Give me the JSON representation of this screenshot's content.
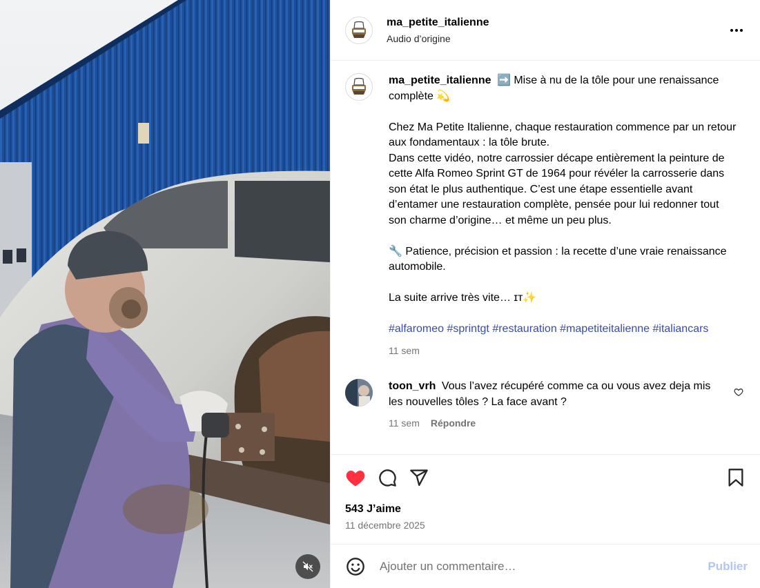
{
  "post": {
    "username": "ma_petite_italienne",
    "audio": "Audio d’origine"
  },
  "caption": {
    "username": "ma_petite_italienne",
    "line1_emoji": "➡️",
    "line1": "Mise à nu de la tôle pour une renaissance complète",
    "line1_end_emoji": "💫",
    "para2": "Chez Ma Petite Italienne, chaque restauration commence par un retour aux fondamentaux : la tôle brute.",
    "para3": "Dans cette vidéo, notre carrossier décape entièrement la peinture de cette Alfa Romeo Sprint GT de 1964 pour révéler la carrosserie dans son état le plus authentique. C’est une étape essentielle avant d’entamer une restauration complète, pensée pour lui redonner tout son charme d’origine… et même un peu plus.",
    "para4_emoji": "🔧",
    "para4": "Patience, précision et passion : la recette d’une vraie renaissance automobile.",
    "para5": "La suite arrive très vite… ɪᴛ✨",
    "hashtags": [
      "#alfaromeo",
      "#sprintgt",
      "#restauration",
      "#mapetiteitalienne",
      "#italiancars"
    ],
    "time": "11 sem"
  },
  "comment": {
    "username": "toon_vrh",
    "text": "Vous l’avez récupéré comme ca ou vous avez deja mis les nouvelles tôles ? La face avant ?",
    "time": "11 sem",
    "reply_label": "Répondre"
  },
  "stats": {
    "likes": "543 J’aime",
    "date": "11 décembre 2025"
  },
  "add_comment": {
    "placeholder": "Ajouter un commentaire…",
    "publish_label": "Publier"
  },
  "colors": {
    "like_red": "#ff3040",
    "hashtag": "#3a4aa8",
    "publish_disabled": "#b2c6f5",
    "muted_text": "#737373"
  },
  "icons": [
    "more-options-icon",
    "heart-filled-icon",
    "comment-icon",
    "share-icon",
    "bookmark-icon",
    "emoji-icon",
    "muted-speaker-icon",
    "heart-outline-icon"
  ]
}
